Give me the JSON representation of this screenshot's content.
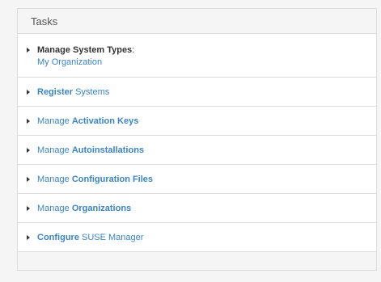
{
  "panel": {
    "title": "Tasks",
    "tasks": [
      {
        "label_bold": "Manage System Types",
        "label_suffix": ":",
        "sub": "My Organization"
      },
      {
        "label_bold": "Register",
        "label_rest": " Systems"
      },
      {
        "label_pre": "Manage ",
        "label_bold": "Activation Keys"
      },
      {
        "label_pre": "Manage ",
        "label_bold": "Autoinstallations"
      },
      {
        "label_pre": "Manage ",
        "label_bold": "Configuration Files"
      },
      {
        "label_pre": "Manage ",
        "label_bold": "Organizations"
      },
      {
        "label_bold": "Configure",
        "label_rest": " SUSE Manager"
      }
    ]
  },
  "colors": {
    "link": "#3a84c6",
    "text": "#333333",
    "border": "#dddddd",
    "panel_bg": "#f5f5f5"
  },
  "icons": {
    "task_expand": "caret-right-icon"
  }
}
